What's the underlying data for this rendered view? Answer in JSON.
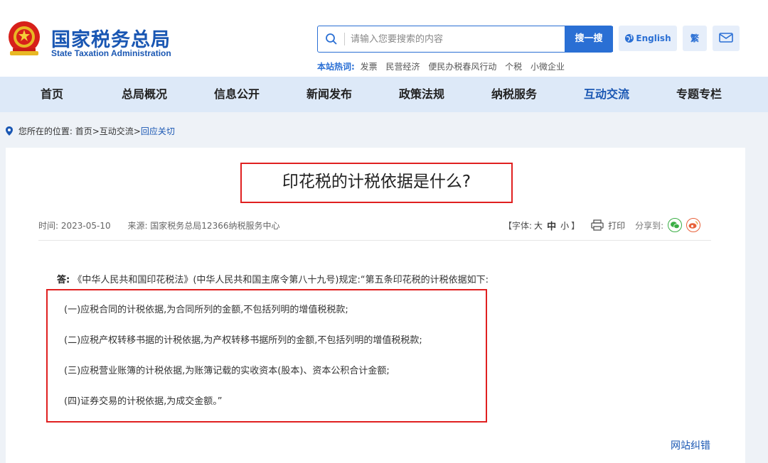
{
  "brand": {
    "name_cn": "国家税务总局",
    "name_en": "State Taxation Administration"
  },
  "search": {
    "placeholder": "请输入您要搜索的内容",
    "button": "搜一搜"
  },
  "hot": {
    "label": "本站热词:",
    "items": [
      "发票",
      "民营经济",
      "便民办税春风行动",
      "个税",
      "小微企业"
    ]
  },
  "lang": {
    "english": "English",
    "traditional": "繁"
  },
  "nav": {
    "items": [
      "首页",
      "总局概况",
      "信息公开",
      "新闻发布",
      "政策法规",
      "纳税服务",
      "互动交流",
      "专题专栏"
    ],
    "active_index": 6
  },
  "breadcrumb": {
    "prefix": "您所在的位置:",
    "home": "首页",
    "sep1": ">",
    "section": "互动交流",
    "sep2": ">",
    "current": "回应关切"
  },
  "article": {
    "title": "印花税的计税依据是什么?",
    "time": "时间: 2023-05-10",
    "source": "来源: 国家税务总局12366纳税服务中心",
    "font_label_open": "【字体:",
    "font_large": "大",
    "font_medium": "中",
    "font_small": "小",
    "font_label_close": "】",
    "print": "打印",
    "share": "分享到:",
    "answer_label": "答:",
    "answer_text": "《中华人民共和国印花税法》(中华人民共和国主席令第八十九号)规定:“第五条印花税的计税依据如下:",
    "items": [
      "(一)应税合同的计税依据,为合同所列的金额,不包括列明的增值税税款;",
      "(二)应税产权转移书据的计税依据,为产权转移书据所列的金额,不包括列明的增值税税款;",
      "(三)应税营业账簿的计税依据,为账簿记载的实收资本(股本)、资本公积合计金额;",
      "(四)证券交易的计税依据,为成交金额。”"
    ]
  },
  "feedback": "网站纠错",
  "colors": {
    "brand_blue": "#1a57b3",
    "accent_blue": "#2a6fd4",
    "nav_bg": "#dde9f8",
    "highlight_red": "#e02020"
  }
}
